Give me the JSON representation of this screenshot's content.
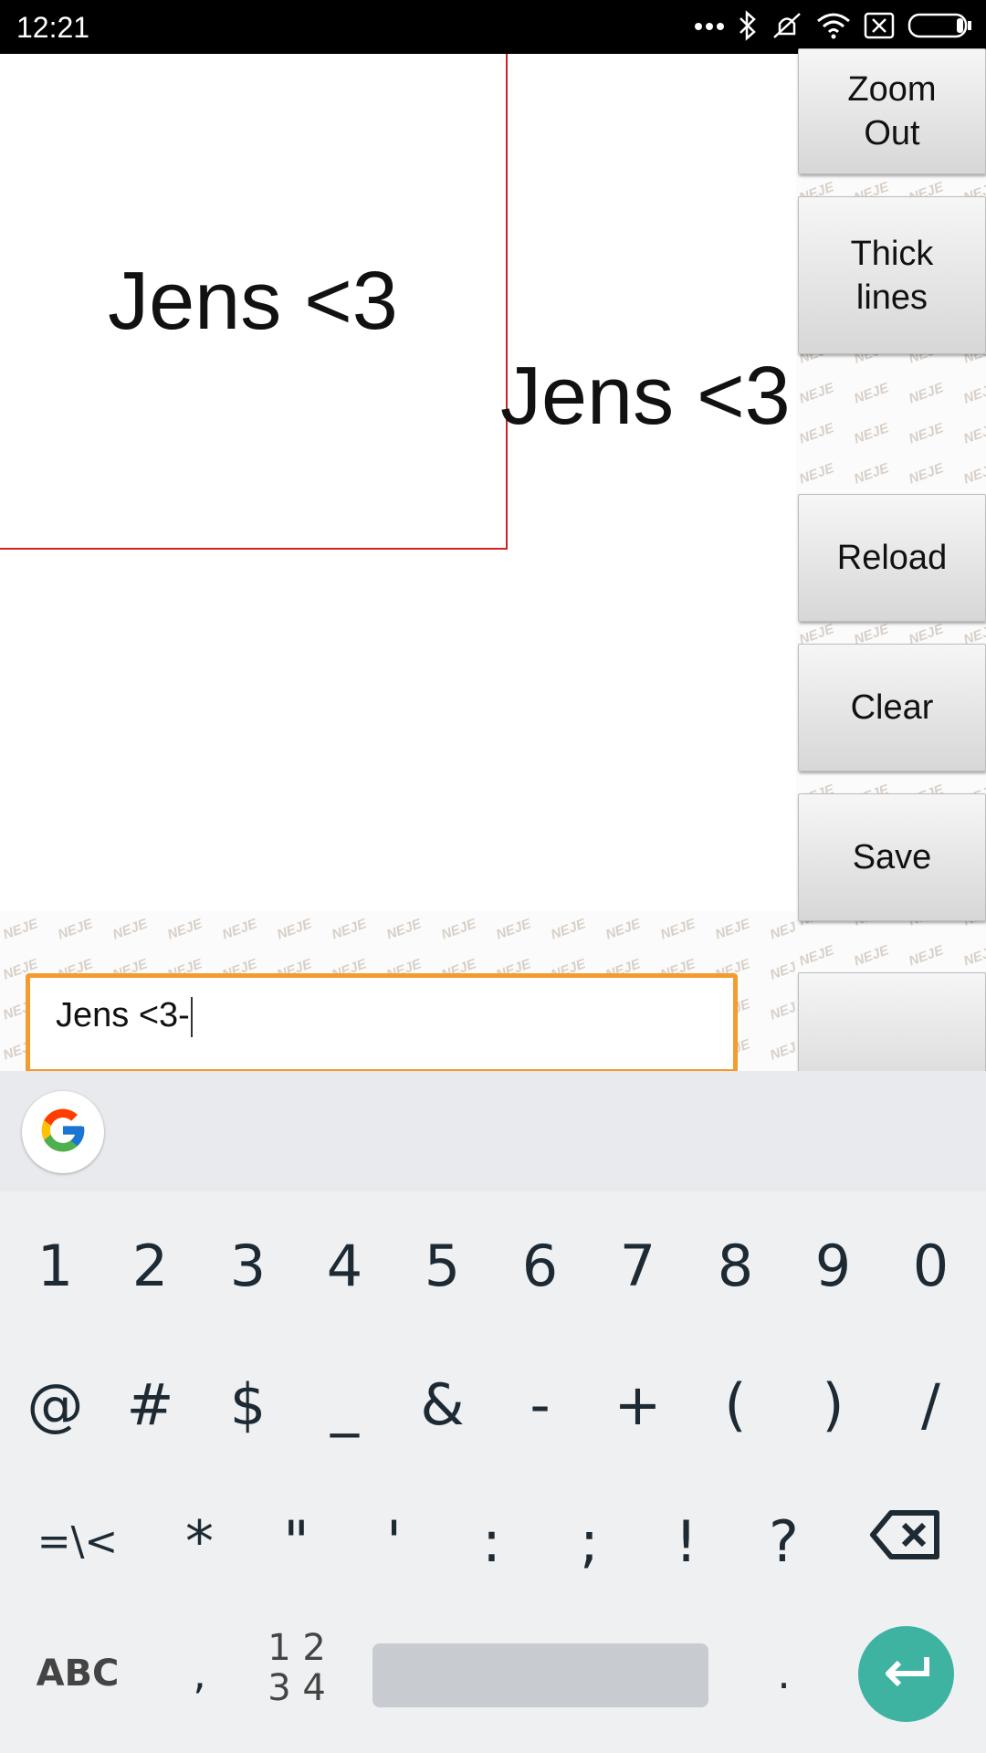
{
  "status_bar": {
    "time": "12:21",
    "icons": [
      "more-dots-icon",
      "bluetooth-icon",
      "silent-vibrate-icon",
      "wifi-icon",
      "sim-blocked-icon",
      "battery-icon"
    ]
  },
  "canvas": {
    "frame_text": "Jens <3",
    "floating_text": "Jens <3"
  },
  "side_buttons": [
    {
      "label": "Zoom\nOut"
    },
    {
      "label": "Thick\nlines"
    },
    {
      "label": "Reload"
    },
    {
      "label": "Clear"
    },
    {
      "label": "Save"
    },
    {
      "label": ""
    }
  ],
  "text_input": {
    "value": "Jens <3-"
  },
  "keyboard": {
    "row1": [
      "1",
      "2",
      "3",
      "4",
      "5",
      "6",
      "7",
      "8",
      "9",
      "0"
    ],
    "row2": [
      "@",
      "#",
      "$",
      "_",
      "&",
      "-",
      "+",
      "(",
      ")",
      "/"
    ],
    "row3": [
      "=\\<",
      "*",
      "\"",
      "'",
      ":",
      ";",
      "!",
      "?"
    ],
    "abc_label": "ABC",
    "comma": ",",
    "num_toggle_line1": "1 2",
    "num_toggle_line2": "3 4",
    "period": "."
  },
  "colors": {
    "frame_border": "#d32020",
    "input_border": "#f49b2e",
    "enter_key": "#3fb3a2"
  }
}
